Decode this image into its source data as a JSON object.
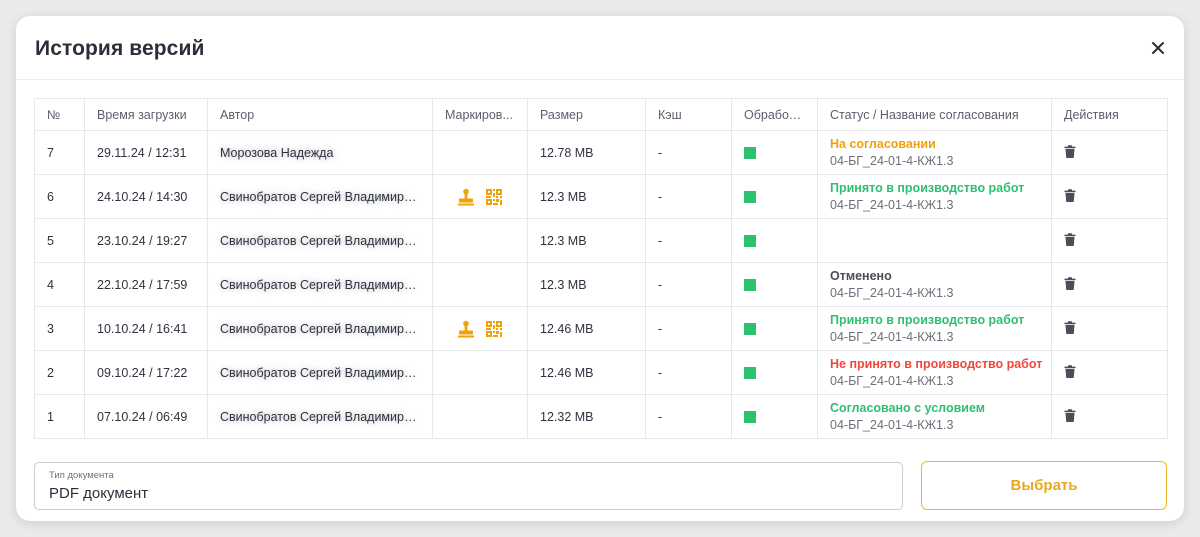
{
  "modal": {
    "title": "История версий",
    "close_icon": "close-icon"
  },
  "colors": {
    "status_pending": "#f0a20a",
    "status_accepted": "#2fbf71",
    "status_rejected": "#f0473c",
    "status_cancelled": "#4a4e59",
    "processing_done": "#2fbf71",
    "accent": "#f0b72a"
  },
  "table": {
    "headers": {
      "num": "№",
      "time": "Время загрузки",
      "author": "Автор",
      "marking": "Маркиров...",
      "size": "Размер",
      "cache": "Кэш",
      "processing": "Обработка",
      "status": "Статус / Название согласования",
      "actions": "Действия"
    },
    "rows": [
      {
        "num": "7",
        "time": "29.11.24 / 12:31",
        "author": "Морозова Надежда",
        "stamp": false,
        "qr": false,
        "size": "12.78 MB",
        "cache": "-",
        "status": "На согласовании",
        "status_kind": "pending",
        "approval": "04-БГ_24-01-4-КЖ1.3"
      },
      {
        "num": "6",
        "time": "24.10.24 / 14:30",
        "author": "Свинобратов Сергей Владимирович",
        "stamp": true,
        "qr": true,
        "size": "12.3 MB",
        "cache": "-",
        "status": "Принято в производство работ",
        "status_kind": "accepted",
        "approval": "04-БГ_24-01-4-КЖ1.3"
      },
      {
        "num": "5",
        "time": "23.10.24 / 19:27",
        "author": "Свинобратов Сергей Владимирович",
        "stamp": false,
        "qr": false,
        "size": "12.3 MB",
        "cache": "-",
        "status": "",
        "status_kind": "none",
        "approval": ""
      },
      {
        "num": "4",
        "time": "22.10.24 / 17:59",
        "author": "Свинобратов Сергей Владимирович",
        "stamp": false,
        "qr": false,
        "size": "12.3 MB",
        "cache": "-",
        "status": "Отменено",
        "status_kind": "cancelled",
        "approval": "04-БГ_24-01-4-КЖ1.3"
      },
      {
        "num": "3",
        "time": "10.10.24 / 16:41",
        "author": "Свинобратов Сергей Владимирович",
        "stamp": true,
        "qr": true,
        "size": "12.46 MB",
        "cache": "-",
        "status": "Принято в производство работ",
        "status_kind": "accepted",
        "approval": "04-БГ_24-01-4-КЖ1.3"
      },
      {
        "num": "2",
        "time": "09.10.24 / 17:22",
        "author": "Свинобратов Сергей Владимирович",
        "stamp": false,
        "qr": false,
        "size": "12.46 MB",
        "cache": "-",
        "status": "Не принято в производство работ",
        "status_kind": "rejected",
        "approval": "04-БГ_24-01-4-КЖ1.3"
      },
      {
        "num": "1",
        "time": "07.10.24 / 06:49",
        "author": "Свинобратов Сергей Владимирович",
        "stamp": false,
        "qr": false,
        "size": "12.32 MB",
        "cache": "-",
        "status": "Согласовано с условием",
        "status_kind": "accepted",
        "approval": "04-БГ_24-01-4-КЖ1.3"
      }
    ]
  },
  "footer": {
    "doc_type_label": "Тип документа",
    "doc_type_value": "PDF документ",
    "select_label": "Выбрать"
  }
}
